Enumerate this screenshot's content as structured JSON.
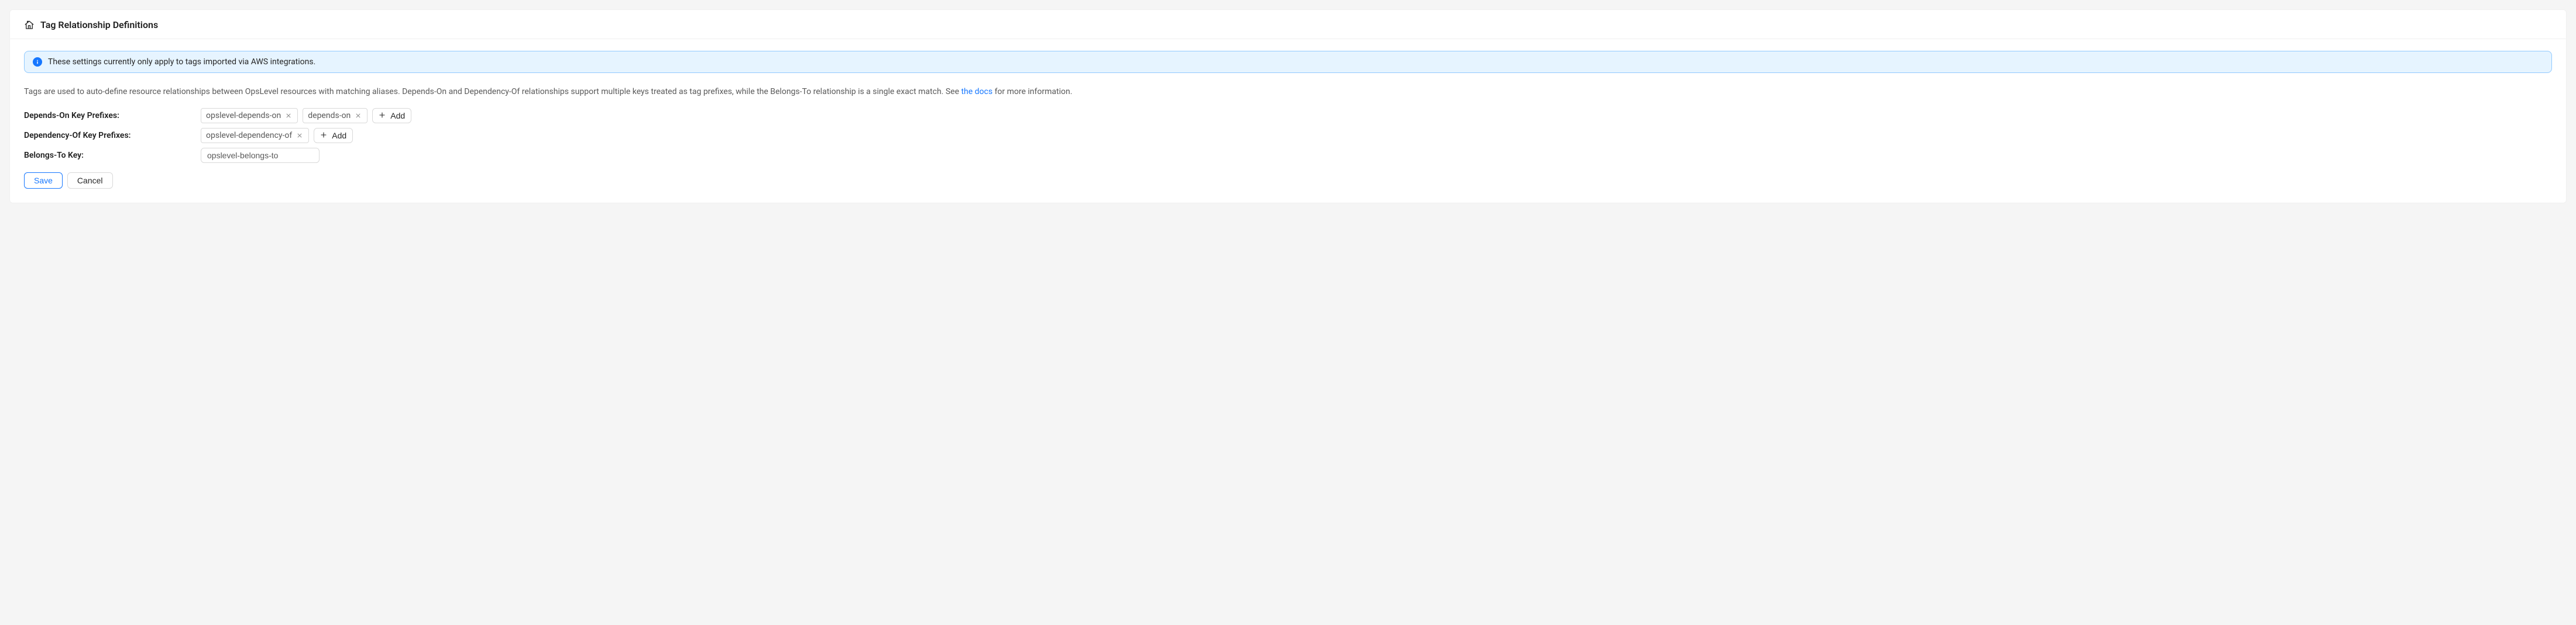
{
  "header": {
    "title": "Tag Relationship Definitions"
  },
  "alert": {
    "text": "These settings currently only apply to tags imported via AWS integrations."
  },
  "description": {
    "pre": "Tags are used to auto-define resource relationships between OpsLevel resources with matching aliases. Depends-On and Dependency-Of relationships support multiple keys treated as tag prefixes, while the Belongs-To relationship is a single exact match. See ",
    "link": "the docs",
    "post": " for more information."
  },
  "rows": {
    "dependsOn": {
      "label": "Depends-On Key Prefixes:",
      "chips": [
        "opslevel-depends-on",
        "depends-on"
      ],
      "add": "Add"
    },
    "dependencyOf": {
      "label": "Dependency-Of Key Prefixes:",
      "chips": [
        "opslevel-dependency-of"
      ],
      "add": "Add"
    },
    "belongsTo": {
      "label": "Belongs-To Key:",
      "value": "opslevel-belongs-to"
    }
  },
  "actions": {
    "save": "Save",
    "cancel": "Cancel"
  }
}
